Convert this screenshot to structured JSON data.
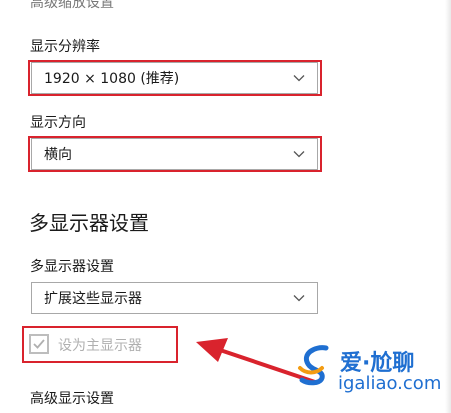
{
  "top_cut_heading": "高级缩放设置",
  "resolution": {
    "label": "显示分辨率",
    "value": "1920 × 1080 (推荐)"
  },
  "orientation": {
    "label": "显示方向",
    "value": "横向"
  },
  "multi_display": {
    "section_title": "多显示器设置",
    "label": "多显示器设置",
    "value": "扩展这些显示器",
    "checkbox_label": "设为主显示器",
    "checkbox_checked": true,
    "checkbox_disabled": true
  },
  "advanced_link": "高级显示设置",
  "watermark": {
    "brand": "爱·尬聊",
    "url": "igaliao.com"
  },
  "colors": {
    "highlight": "#d9232d",
    "watermark": "#1f6fd1"
  },
  "icons": {
    "dropdown": "chevron-down-icon",
    "checkbox": "checkmark-icon",
    "logo": "swirl-logo-icon",
    "annotation": "red-arrow"
  }
}
